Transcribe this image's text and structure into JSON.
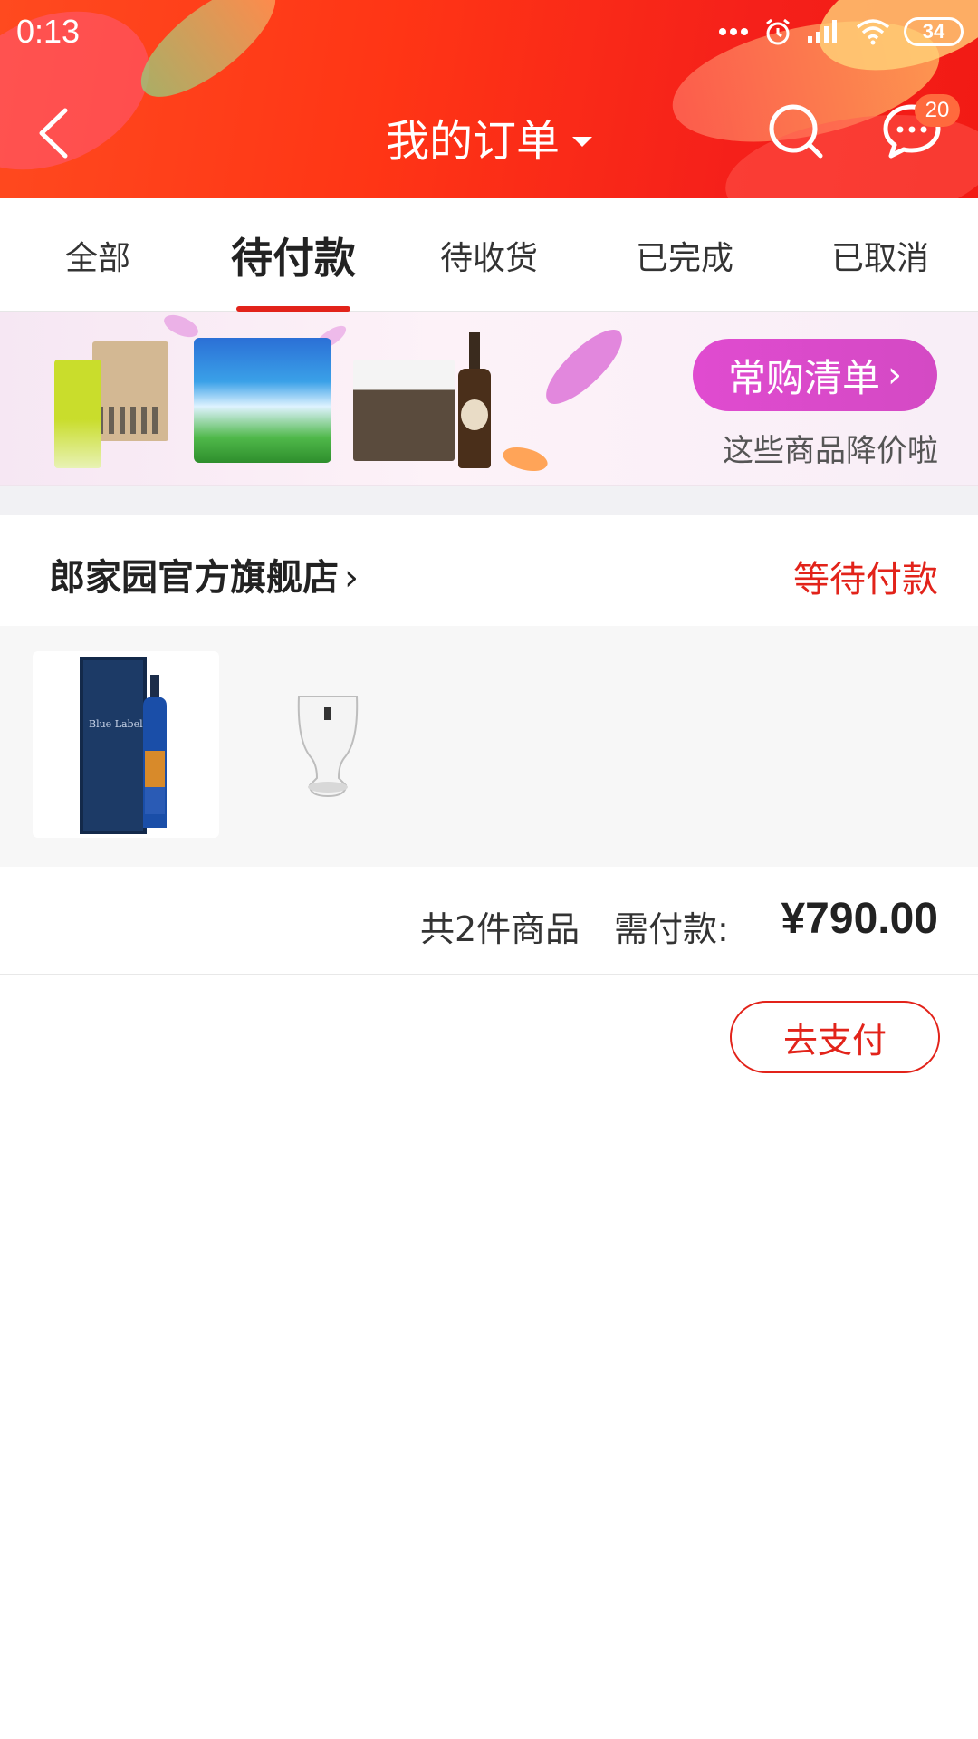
{
  "status_bar": {
    "time": "0:13",
    "battery": "34"
  },
  "header": {
    "title": "我的订单",
    "message_badge": "20"
  },
  "tabs": [
    {
      "label": "全部",
      "active": false
    },
    {
      "label": "待付款",
      "active": true
    },
    {
      "label": "待收货",
      "active": false
    },
    {
      "label": "已完成",
      "active": false
    },
    {
      "label": "已取消",
      "active": false
    }
  ],
  "banner": {
    "button_label": "常购清单",
    "subtitle": "这些商品降价啦"
  },
  "order": {
    "shop_name": "郎家园官方旗舰店",
    "status": "等待付款",
    "item_count_text": "共2件商品",
    "amount_label": "需付款:",
    "amount": "¥790.00",
    "pay_button": "去支付"
  },
  "colors": {
    "brand_red": "#e2231a",
    "header_gradient_start": "#ff4a1f",
    "banner_button": "#e04bd0"
  }
}
